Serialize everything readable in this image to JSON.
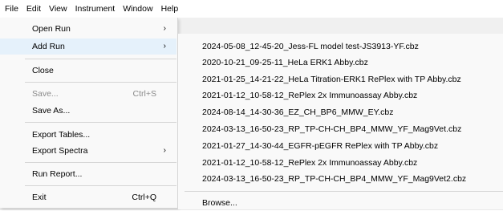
{
  "menubar": {
    "items": [
      "File",
      "Edit",
      "View",
      "Instrument",
      "Window",
      "Help"
    ]
  },
  "file_menu": {
    "open_run": "Open Run",
    "add_run": "Add Run",
    "close": "Close",
    "save": "Save...",
    "save_shortcut": "Ctrl+S",
    "save_as": "Save As...",
    "export_tables": "Export Tables...",
    "export_spectra": "Export Spectra",
    "run_report": "Run Report...",
    "exit": "Exit",
    "exit_shortcut": "Ctrl+Q",
    "submenu_arrow": "›"
  },
  "recent_runs": {
    "files": [
      "2024-05-08_12-45-20_Jess-FL model test-JS3913-YF.cbz",
      "2020-10-21_09-25-11_HeLa ERK1 Abby.cbz",
      "2021-01-25_14-21-22_HeLa Titration-ERK1 RePlex with TP Abby.cbz",
      "2021-01-12_10-58-12_RePlex 2x Immunoassay Abby.cbz",
      "2024-08-14_14-30-36_EZ_CH_BP6_MMW_EY.cbz",
      "2024-03-13_16-50-23_RP_TP-CH-CH_BP4_MMW_YF_Mag9Vet.cbz",
      "2021-01-27_14-30-44_EGFR-pEGFR RePlex with TP Abby.cbz",
      "2021-01-12_10-58-12_RePlex 2x Immunoassay Abby.cbz",
      "2024-03-13_16-50-23_RP_TP-CH-CH_BP4_MMW_YF_Mag9Vet2.cbz"
    ],
    "browse": "Browse..."
  },
  "colors": {
    "hover": "#e5f1fb",
    "menu_bg": "#f9f9f9",
    "disabled_text": "#8a8a8a"
  }
}
